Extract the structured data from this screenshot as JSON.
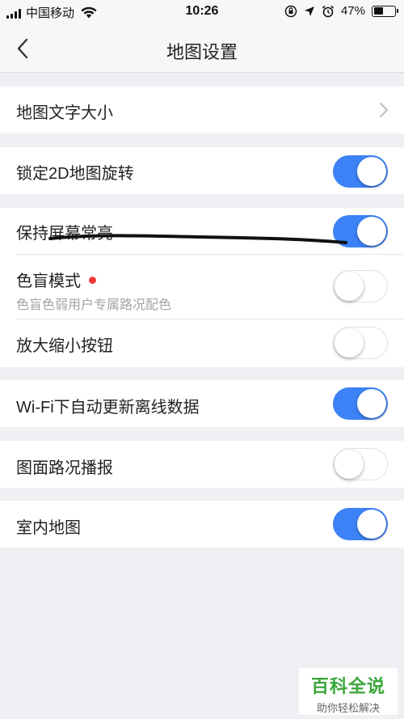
{
  "status_bar": {
    "carrier": "中国移动",
    "time": "10:26",
    "battery_percent": "47%",
    "battery_level": 0.47,
    "icons": [
      "signal-icon",
      "wifi-icon",
      "orientation-lock-icon",
      "location-icon",
      "alarm-icon",
      "battery-icon"
    ]
  },
  "nav": {
    "title": "地图设置",
    "back_icon": "chevron-left-icon"
  },
  "settings": {
    "map_text_size": {
      "label": "地图文字大小",
      "type": "link"
    },
    "lock_2d_rotation": {
      "label": "锁定2D地图旋转",
      "on": true
    },
    "keep_screen_on": {
      "label": "保持屏幕常亮",
      "on": true
    },
    "color_blind_mode": {
      "label": "色盲模式",
      "sublabel": "色盲色弱用户专属路况配色",
      "on": false,
      "new_badge": true
    },
    "zoom_buttons": {
      "label": "放大缩小按钮",
      "on": false
    },
    "wifi_auto_update": {
      "label": "Wi-Fi下自动更新离线数据",
      "on": true
    },
    "traffic_broadcast": {
      "label": "图面路况播报",
      "on": false
    },
    "indoor_map": {
      "label": "室内地图",
      "on": true
    }
  },
  "colors": {
    "toggle_on": "#3d82f6",
    "background": "#efeff4",
    "badge": "#f23b3b"
  },
  "watermark": {
    "title": "百科全说",
    "subtitle": "助你轻松解决"
  }
}
